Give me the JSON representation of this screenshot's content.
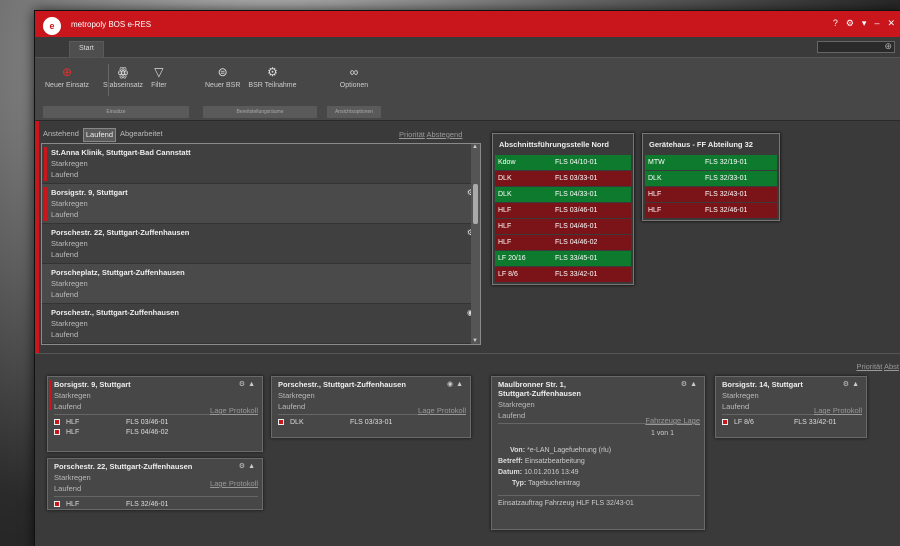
{
  "app": {
    "title": "metropoly BOS e-RES",
    "logo_text": "e"
  },
  "window_controls": [
    "?",
    "⚙",
    "▾",
    "–",
    "✕"
  ],
  "tabs": {
    "start": "Start"
  },
  "ribbon": {
    "groups": [
      {
        "label": "Einsätze",
        "buttons": [
          {
            "label": "Neuer Einsatz",
            "icon": "new-incident-icon",
            "glyph": "⊕"
          },
          {
            "label": "Stabseinsatz",
            "icon": "staff-icon",
            "glyph": "ꙮ"
          },
          {
            "label": "Filter",
            "icon": "filter-icon",
            "glyph": "▽"
          }
        ]
      },
      {
        "label": "Bereitstellungsräume",
        "buttons": [
          {
            "label": "Neuer BSR",
            "icon": "bsr-icon",
            "glyph": "⊜"
          },
          {
            "label": "BSR Teilnahme",
            "icon": "bsr-join-icon",
            "glyph": "⚙"
          }
        ]
      },
      {
        "label": "Ansichtsoptionen",
        "buttons": [
          {
            "label": "Optionen",
            "icon": "options-icon",
            "glyph": "∞"
          }
        ]
      }
    ]
  },
  "filter": {
    "anstehend": "Anstehend",
    "laufend": "Laufend",
    "abgearbeitet": "Abgearbeitet"
  },
  "sort": {
    "prioritaet": "Priorität",
    "abstg": "Abstegend"
  },
  "incidents": [
    {
      "address": "St.Anna Klinik, Stuttgart-Bad Cannstatt",
      "keyword": "Starkregen",
      "status": "Laufend",
      "marked": true,
      "icon": ""
    },
    {
      "address": "Borsigstr. 9, Stuttgart",
      "keyword": "Starkregen",
      "status": "Laufend",
      "marked": true,
      "icon": "⚙"
    },
    {
      "address": "Porschestr. 22, Stuttgart-Zuffenhausen",
      "keyword": "Starkregen",
      "status": "Laufend",
      "marked": false,
      "icon": "⚙"
    },
    {
      "address": "Porscheplatz, Stuttgart-Zuffenhausen",
      "keyword": "Starkregen",
      "status": "Laufend",
      "marked": false,
      "icon": ""
    },
    {
      "address": "Porschestr., Stuttgart-Zuffenhausen",
      "keyword": "Starkregen",
      "status": "Laufend",
      "marked": false,
      "icon": "◉"
    }
  ],
  "vehicle_tables": [
    {
      "title": "Abschnittsführungsstelle Nord",
      "rows": [
        {
          "veh": "Kdow",
          "fls": "FLS 04/10-01",
          "color": "green"
        },
        {
          "veh": "DLK",
          "fls": "FLS 03/33-01",
          "color": "red"
        },
        {
          "veh": "DLK",
          "fls": "FLS 04/33-01",
          "color": "green"
        },
        {
          "veh": "HLF",
          "fls": "FLS 03/46-01",
          "color": "red"
        },
        {
          "veh": "HLF",
          "fls": "FLS 04/46-01",
          "color": "red"
        },
        {
          "veh": "HLF",
          "fls": "FLS 04/46-02",
          "color": "red"
        },
        {
          "veh": "LF 20/16",
          "fls": "FLS 33/45-01",
          "color": "green"
        },
        {
          "veh": "LF 8/6",
          "fls": "FLS 33/42-01",
          "color": "red"
        }
      ]
    },
    {
      "title": "Gerätehaus - FF Abteilung 32",
      "rows": [
        {
          "veh": "MTW",
          "fls": "FLS 32/19-01",
          "color": "green"
        },
        {
          "veh": "DLK",
          "fls": "FLS 32/33-01",
          "color": "green"
        },
        {
          "veh": "HLF",
          "fls": "FLS 32/43-01",
          "color": "red"
        },
        {
          "veh": "HLF",
          "fls": "FLS 32/46-01",
          "color": "red"
        }
      ]
    }
  ],
  "lower_sort": {
    "prioritaet": "Priorität",
    "abst": "Abst"
  },
  "cards": {
    "c1": {
      "address": "Borsigstr. 9, Stuttgart",
      "keyword": "Starkregen",
      "status": "Laufend",
      "lage": "Lage",
      "protokoll": "Protokoll",
      "rows": [
        {
          "veh": "HLF",
          "fls": "FLS 03/46-01"
        },
        {
          "veh": "HLF",
          "fls": "FLS 04/46-02"
        }
      ]
    },
    "c2": {
      "address": "Porschestr. 22, Stuttgart-Zuffenhausen",
      "keyword": "Starkregen",
      "status": "Laufend",
      "lage": "Lage",
      "protokoll": "Protokoll",
      "rows": [
        {
          "veh": "HLF",
          "fls": "FLS 32/46-01"
        }
      ]
    },
    "c3": {
      "address": "Porschestr., Stuttgart-Zuffenhausen",
      "keyword": "Starkregen",
      "status": "Laufend",
      "lage": "Lage",
      "protokoll": "Protokoll",
      "rows": [
        {
          "veh": "DLK",
          "fls": "FLS 03/33-01"
        }
      ]
    },
    "c4": {
      "address1": "Maulbronner Str. 1,",
      "address2": "Stuttgart-Zuffenhausen",
      "keyword": "Starkregen",
      "status": "Laufend",
      "fahrzeuge": "Fahrzeuge",
      "lage": "Lage",
      "pager": "1 von 1",
      "von_k": "Von:",
      "von_v": "*e-LAN_Lagefuehrung (rlu)",
      "betreff_k": "Betreff:",
      "betreff_v": "Einsatzbearbeitung",
      "datum_k": "Datum:",
      "datum_v": "10.01.2016 13:49",
      "typ_k": "Typ:",
      "typ_v": "Tagebucheintrag",
      "footer": "Einsatzauftrag Fahrzeug HLF FLS 32/43-01"
    },
    "c5": {
      "address": "Borsigstr. 14, Stuttgart",
      "keyword": "Starkregen",
      "status": "Laufend",
      "lage": "Lage",
      "protokoll": "Protokoll",
      "rows": [
        {
          "veh": "LF 8/6",
          "fls": "FLS 33/42-01"
        }
      ]
    }
  }
}
